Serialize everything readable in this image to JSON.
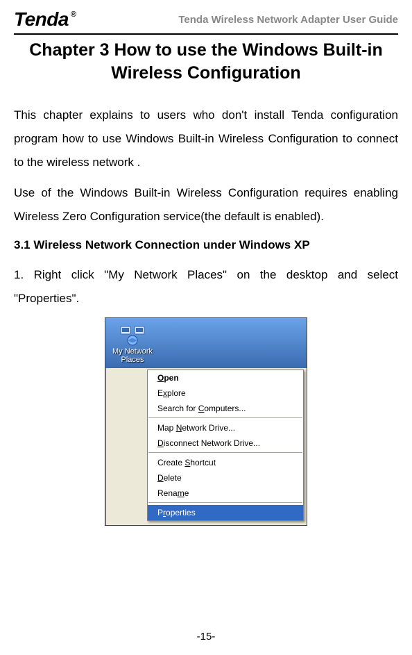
{
  "header": {
    "brand": "Tenda",
    "doc_title": "Tenda Wireless Network Adapter User Guide"
  },
  "chapter": {
    "title": "Chapter 3 How to use the Windows Built-in Wireless Configuration"
  },
  "paragraphs": {
    "p1": "This chapter explains to users who don't install Tenda configuration program how to use Windows Built-in Wireless Configuration to connect to the wireless network .",
    "p2": "Use of the Windows Built-in Wireless Configuration requires enabling Wireless Zero Configuration service(the default is enabled)."
  },
  "section": {
    "title": "3.1 Wireless Network Connection under Windows XP"
  },
  "step1": "1. Right click \"My Network Places\" on the desktop and select \"Properties\".",
  "screenshot": {
    "icon_label": "My Network Places",
    "menu": {
      "open": "Open",
      "explore": "Explore",
      "search": "Search for Computers...",
      "map": "Map Network Drive...",
      "disconnect": "Disconnect Network Drive...",
      "shortcut": "Create Shortcut",
      "delete": "Delete",
      "rename": "Rename",
      "properties": "Properties"
    }
  },
  "footer": {
    "page_number": "-15-"
  }
}
